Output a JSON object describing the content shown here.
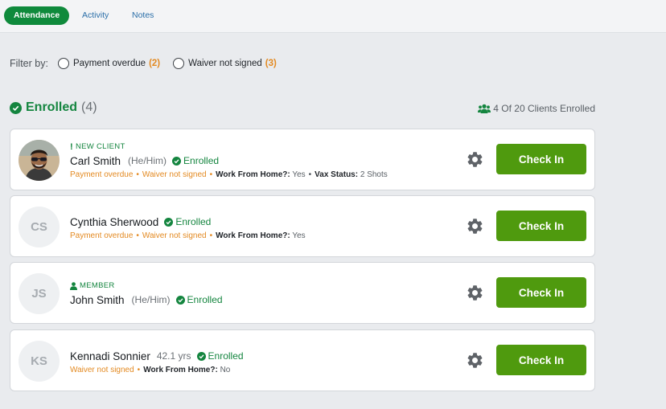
{
  "tabs": [
    {
      "label": "Attendance",
      "active": true
    },
    {
      "label": "Activity",
      "active": false
    },
    {
      "label": "Notes",
      "active": false
    }
  ],
  "filter": {
    "label": "Filter by:",
    "options": [
      {
        "label": "Payment overdue",
        "count": "(2)"
      },
      {
        "label": "Waiver not signed",
        "count": "(3)"
      }
    ]
  },
  "enrolled": {
    "title": "Enrolled",
    "count": "(4)",
    "summary": "4 Of 20 Clients Enrolled"
  },
  "clients": [
    {
      "tag": "NEW CLIENT",
      "tag_icon": "exclamation-icon",
      "name": "Carl Smith",
      "pronouns": "(He/Him)",
      "status": "Enrolled",
      "avatar": "photo",
      "warnings": [
        "Payment overdue",
        "Waiver not signed"
      ],
      "fields": [
        {
          "key": "Work From Home?:",
          "value": "Yes"
        },
        {
          "key": "Vax Status:",
          "value": "2 Shots"
        }
      ],
      "action": "Check In"
    },
    {
      "name": "Cynthia Sherwood",
      "status": "Enrolled",
      "avatar": "CS",
      "warnings": [
        "Payment overdue",
        "Waiver not signed"
      ],
      "fields": [
        {
          "key": "Work From Home?:",
          "value": "Yes"
        }
      ],
      "action": "Check In"
    },
    {
      "tag": "MEMBER",
      "tag_icon": "person-icon",
      "name": "John Smith",
      "pronouns": "(He/Him)",
      "status": "Enrolled",
      "avatar": "JS",
      "action": "Check In"
    },
    {
      "name": "Kennadi Sonnier",
      "age": "42.1 yrs",
      "status": "Enrolled",
      "avatar": "KS",
      "warnings": [
        "Waiver not signed"
      ],
      "fields": [
        {
          "key": "Work From Home?:",
          "value": "No"
        }
      ],
      "action": "Check In"
    }
  ],
  "colors": {
    "accent_green": "#14853f",
    "button_green": "#4f9a0e",
    "warning_orange": "#e38a22",
    "link_blue": "#2a6ea8",
    "background": "#e9ebee"
  }
}
